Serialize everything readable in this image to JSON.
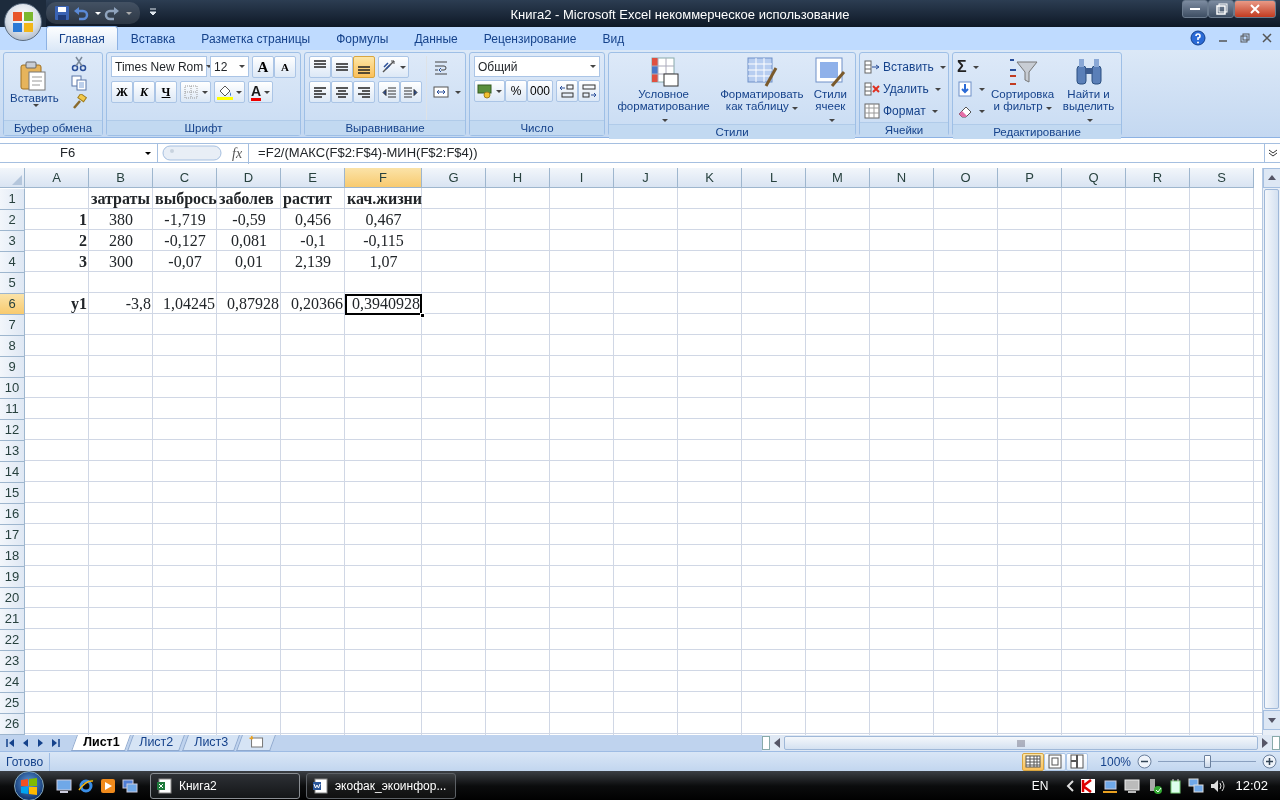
{
  "window": {
    "title": "Книга2 - Microsoft Excel некоммерческое использование"
  },
  "ribbon_tabs": [
    {
      "label": "Главная",
      "selected": true
    },
    {
      "label": "Вставка",
      "selected": false
    },
    {
      "label": "Разметка страницы",
      "selected": false
    },
    {
      "label": "Формулы",
      "selected": false
    },
    {
      "label": "Данные",
      "selected": false
    },
    {
      "label": "Рецензирование",
      "selected": false
    },
    {
      "label": "Вид",
      "selected": false
    }
  ],
  "ribbon_groups": [
    {
      "kind": "clipboard",
      "label": "Буфер обмена",
      "paste": "Вставить"
    },
    {
      "kind": "font",
      "label": "Шрифт",
      "font_name": "Times New Rom",
      "font_size": "12",
      "grow": "A",
      "shrink": "A",
      "bold": "Ж",
      "italic": "К",
      "underline": "Ч",
      "font_color": "A"
    },
    {
      "kind": "alignment",
      "label": "Выравнивание",
      "vertical": [
        {
          "kind": "top",
          "selected": false
        },
        {
          "kind": "middle",
          "selected": false
        },
        {
          "kind": "bottom",
          "selected": true
        }
      ]
    },
    {
      "kind": "number",
      "label": "Число",
      "format": "Общий",
      "percent": "%",
      "thousands": "000"
    },
    {
      "kind": "styles",
      "label": "Стили",
      "commands": [
        "Условное\nформатирование",
        "Форматировать\nкак таблицу",
        "Стили\nячеек"
      ]
    },
    {
      "kind": "cells",
      "label": "Ячейки",
      "commands": [
        "Вставить",
        "Удалить",
        "Формат"
      ]
    },
    {
      "kind": "editing",
      "label": "Редактирование",
      "sum": "Σ",
      "commands": [
        "Сортировка\nи фильтр",
        "Найти и\nвыделить"
      ]
    }
  ],
  "name_box": "F6",
  "fx": "fx",
  "formula": "=F2/(МАКС(F$2:F$4)-МИН(F$2:F$4))",
  "sheet": {
    "columns": [
      {
        "label": "A",
        "selected": false
      },
      {
        "label": "B",
        "selected": false
      },
      {
        "label": "C",
        "selected": false
      },
      {
        "label": "D",
        "selected": false
      },
      {
        "label": "E",
        "selected": false
      },
      {
        "label": "F",
        "selected": true
      },
      {
        "label": "G",
        "selected": false
      },
      {
        "label": "H",
        "selected": false
      },
      {
        "label": "I",
        "selected": false
      },
      {
        "label": "J",
        "selected": false
      },
      {
        "label": "K",
        "selected": false
      },
      {
        "label": "L",
        "selected": false
      },
      {
        "label": "M",
        "selected": false
      },
      {
        "label": "N",
        "selected": false
      },
      {
        "label": "O",
        "selected": false
      },
      {
        "label": "P",
        "selected": false
      },
      {
        "label": "Q",
        "selected": false
      },
      {
        "label": "R",
        "selected": false
      },
      {
        "label": "S",
        "selected": false
      }
    ],
    "rows": [
      {
        "label": "1",
        "selected": false,
        "cells": [
          null,
          {
            "text": "затраты",
            "bold": true,
            "selected": false
          },
          {
            "text": "выбрось",
            "bold": true,
            "selected": false
          },
          {
            "text": "заболев",
            "bold": true,
            "selected": false
          },
          {
            "text": "растит",
            "bold": true,
            "selected": false
          },
          {
            "text": "кач.жизни",
            "bold": true,
            "selected": false
          }
        ]
      },
      {
        "label": "2",
        "selected": false,
        "cells": [
          {
            "text": "1",
            "bold": true,
            "selected": false
          },
          {
            "text": "380",
            "bold": false,
            "selected": false
          },
          {
            "text": "-1,719",
            "bold": false,
            "selected": false
          },
          {
            "text": "-0,59",
            "bold": false,
            "selected": false
          },
          {
            "text": "0,456",
            "bold": false,
            "selected": false
          },
          {
            "text": "0,467",
            "bold": false,
            "selected": false
          }
        ]
      },
      {
        "label": "3",
        "selected": false,
        "cells": [
          {
            "text": "2",
            "bold": true,
            "selected": false
          },
          {
            "text": "280",
            "bold": false,
            "selected": false
          },
          {
            "text": "-0,127",
            "bold": false,
            "selected": false
          },
          {
            "text": "0,081",
            "bold": false,
            "selected": false
          },
          {
            "text": "-0,1",
            "bold": false,
            "selected": false
          },
          {
            "text": "-0,115",
            "bold": false,
            "selected": false
          }
        ]
      },
      {
        "label": "4",
        "selected": false,
        "cells": [
          {
            "text": "3",
            "bold": true,
            "selected": false
          },
          {
            "text": "300",
            "bold": false,
            "selected": false
          },
          {
            "text": "-0,07",
            "bold": false,
            "selected": false
          },
          {
            "text": "0,01",
            "bold": false,
            "selected": false
          },
          {
            "text": "2,139",
            "bold": false,
            "selected": false
          },
          {
            "text": "1,07",
            "bold": false,
            "selected": false
          }
        ]
      },
      {
        "label": "5",
        "selected": false
      },
      {
        "label": "6",
        "selected": true,
        "cells": [
          {
            "text": "y1",
            "bold": true,
            "selected": false
          },
          {
            "text": "-3,8",
            "bold": false,
            "selected": false
          },
          {
            "text": "1,04245",
            "bold": false,
            "selected": false
          },
          {
            "text": "0,87928",
            "bold": false,
            "selected": false
          },
          {
            "text": "0,20366",
            "bold": false,
            "selected": false
          },
          {
            "text": "0,3940928",
            "bold": false,
            "selected": true
          }
        ]
      },
      {
        "label": "7",
        "selected": false
      },
      {
        "label": "8",
        "selected": false
      },
      {
        "label": "9",
        "selected": false
      },
      {
        "label": "10",
        "selected": false
      },
      {
        "label": "11",
        "selected": false
      },
      {
        "label": "12",
        "selected": false
      },
      {
        "label": "13",
        "selected": false
      },
      {
        "label": "14",
        "selected": false
      },
      {
        "label": "15",
        "selected": false
      },
      {
        "label": "16",
        "selected": false
      },
      {
        "label": "17",
        "selected": false
      },
      {
        "label": "18",
        "selected": false
      },
      {
        "label": "19",
        "selected": false
      },
      {
        "label": "20",
        "selected": false
      },
      {
        "label": "21",
        "selected": false
      },
      {
        "label": "22",
        "selected": false
      },
      {
        "label": "23",
        "selected": false
      },
      {
        "label": "24",
        "selected": false
      },
      {
        "label": "25",
        "selected": false
      },
      {
        "label": "26",
        "selected": false
      }
    ]
  },
  "sheet_tabs": [
    {
      "label": "Лист1",
      "selected": true
    },
    {
      "label": "Лист2",
      "selected": false
    },
    {
      "label": "Лист3",
      "selected": false
    }
  ],
  "status_bar": {
    "text": "Готово",
    "views": [
      {
        "kind": "normal",
        "selected": true
      },
      {
        "kind": "page_layout",
        "selected": false
      },
      {
        "kind": "page_break",
        "selected": false
      }
    ],
    "zoom": "100%",
    "zoom_slider": {
      "level": 0.5
    }
  },
  "taskbar": {
    "tasks": [
      {
        "label": "Книга2",
        "kind": "excel",
        "selected": true
      },
      {
        "label": "экофак_экоинфор...",
        "kind": "word",
        "selected": false
      }
    ],
    "language": "EN",
    "clock": "12:02"
  }
}
